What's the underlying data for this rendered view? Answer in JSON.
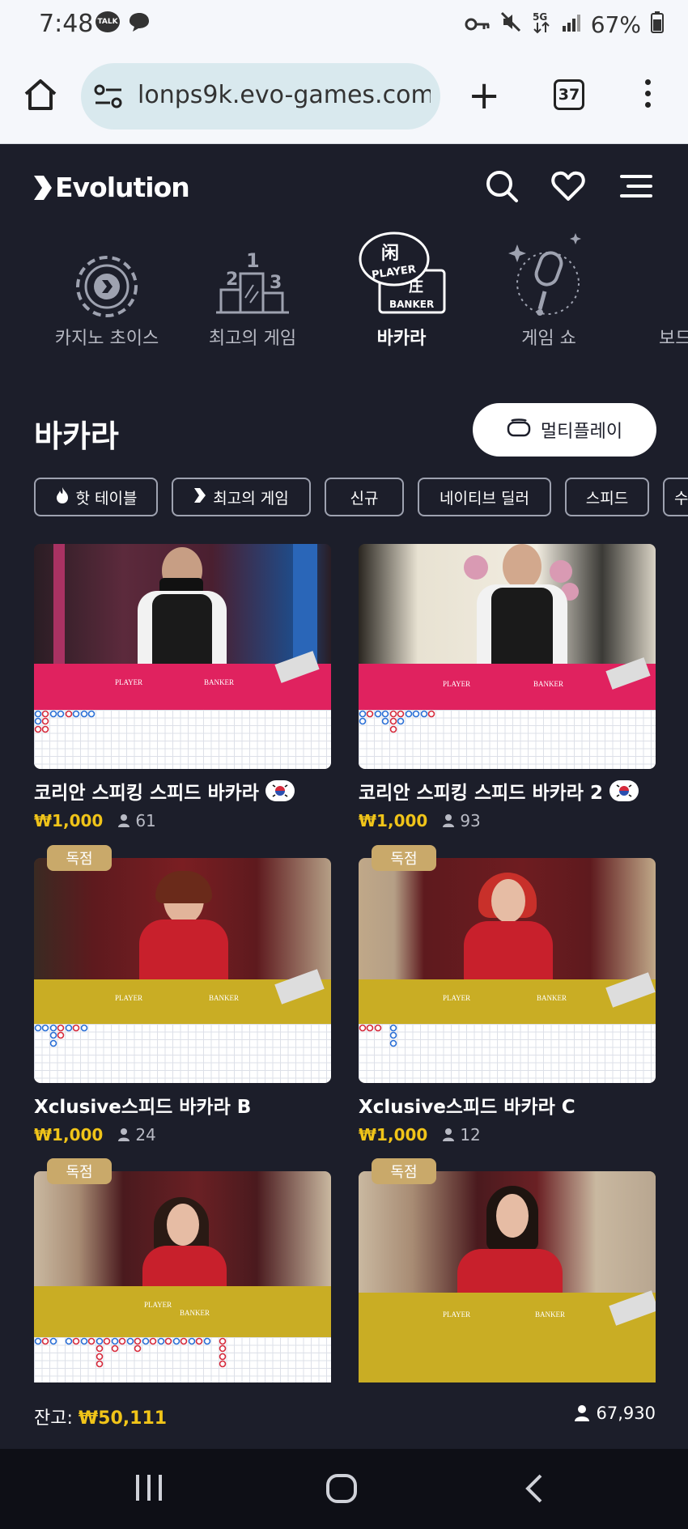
{
  "status_bar": {
    "time": "7:48",
    "talk_badge": "TALK",
    "battery": "67%"
  },
  "browser": {
    "url": "lonps9k.evo-games.com",
    "tab_count": "37"
  },
  "app": {
    "brand": "Evolution"
  },
  "categories": [
    {
      "label": "카지노 초이스",
      "icon": "casino-chip-icon"
    },
    {
      "label": "최고의 게임",
      "icon": "podium-icon"
    },
    {
      "label": "바카라",
      "icon": "baccarat-icon",
      "icon_text": {
        "top": "闲",
        "player": "PLAYER",
        "banker": "BANKER",
        "bottom": "庄"
      }
    },
    {
      "label": "게임 쇼",
      "icon": "microphone-icon"
    },
    {
      "label": "보드",
      "icon": "dice-icon"
    }
  ],
  "section": {
    "title": "바카라",
    "multiplay_label": "멀티플레이"
  },
  "filters": [
    {
      "label": "핫 테이블",
      "icon": "flame-icon"
    },
    {
      "label": "최고의 게임",
      "icon": "evo-arrow-icon"
    },
    {
      "label": "신규"
    },
    {
      "label": "네이티브 딜러"
    },
    {
      "label": "스피드"
    },
    {
      "label": "수"
    }
  ],
  "games": [
    {
      "name": "코리안 스피킹 스피드 바카라",
      "bet": "₩1,000",
      "players": "61",
      "flag": "korea-flag-icon",
      "badge": ""
    },
    {
      "name": "코리안 스피킹 스피드 바카라 2",
      "bet": "₩1,000",
      "players": "93",
      "flag": "korea-flag-icon",
      "badge": ""
    },
    {
      "name": "Xclusive스피드 바카라 B",
      "bet": "₩1,000",
      "players": "24",
      "badge": "독점"
    },
    {
      "name": "Xclusive스피드 바카라 C",
      "bet": "₩1,000",
      "players": "12",
      "badge": "독점"
    },
    {
      "name": "",
      "bet": "",
      "players": "",
      "badge": "독점"
    },
    {
      "name": "",
      "bet": "",
      "players": "",
      "badge": "독점"
    }
  ],
  "felt_text": {
    "player": "PLAYER",
    "banker": "BANKER"
  },
  "footer": {
    "balance_label": "잔고:",
    "balance_value": "₩50,111",
    "online_count": "67,930"
  },
  "colors": {
    "background": "#1c1e2a",
    "accent_gold": "#f0c419",
    "badge_gold": "#c9a96a",
    "felt_pink": "#e0225f",
    "felt_yellow": "#c9ad24"
  }
}
